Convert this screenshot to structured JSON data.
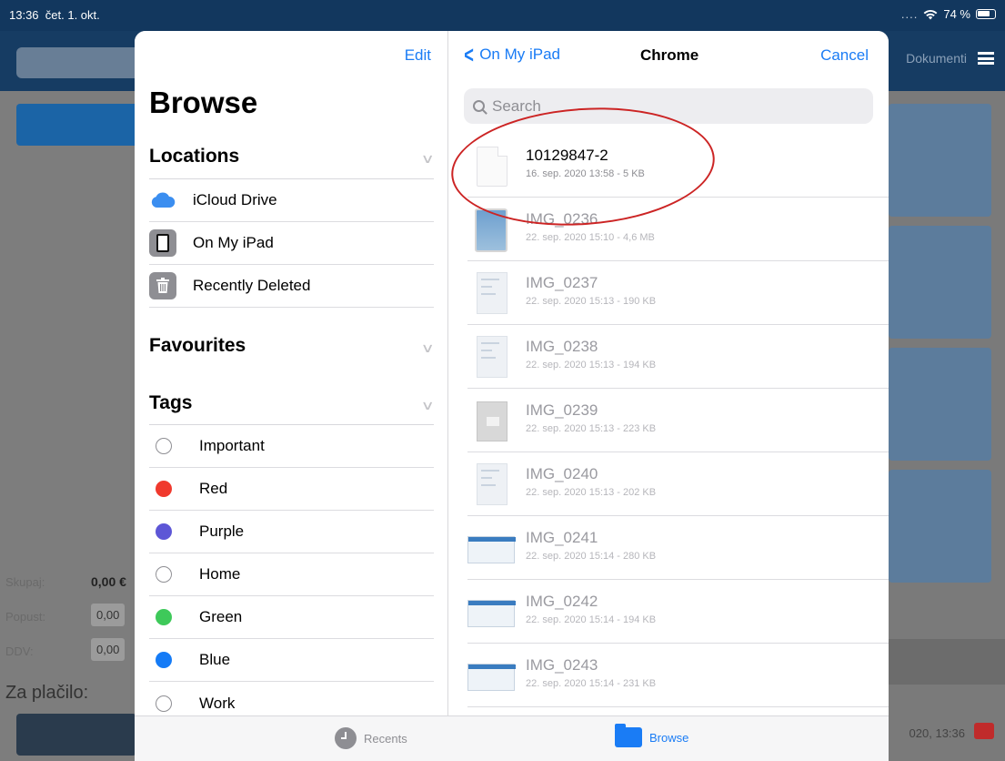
{
  "status": {
    "time": "13:36",
    "date": "čet. 1. okt.",
    "signal": "....",
    "wifi": "wifi-icon",
    "battery": "74 %"
  },
  "background": {
    "dokumenti_label": "Dokumenti",
    "skupaj_label": "Skupaj:",
    "skupaj_value": "0,00 €",
    "popust_label": "Popust:",
    "popust_value": "0,00",
    "ddv_label": "DDV:",
    "ddv_value": "0,00",
    "za_placilo_label": "Za plačilo:",
    "datetime": "020, 13:36"
  },
  "sidebar": {
    "edit_label": "Edit",
    "title": "Browse",
    "locations_label": "Locations",
    "locations": [
      {
        "label": "iCloud Drive",
        "icon": "cloud-icon"
      },
      {
        "label": "On My iPad",
        "icon": "ipad-icon"
      },
      {
        "label": "Recently Deleted",
        "icon": "trash-icon"
      }
    ],
    "favourites_label": "Favourites",
    "tags_label": "Tags",
    "tags": [
      {
        "label": "Important",
        "color": ""
      },
      {
        "label": "Red",
        "color": "#f0392d"
      },
      {
        "label": "Purple",
        "color": "#5d56d6"
      },
      {
        "label": "Home",
        "color": ""
      },
      {
        "label": "Green",
        "color": "#3ec95a"
      },
      {
        "label": "Blue",
        "color": "#157bf6"
      },
      {
        "label": "Work",
        "color": ""
      }
    ]
  },
  "content": {
    "back_label": "On My iPad",
    "title": "Chrome",
    "cancel_label": "Cancel",
    "search_placeholder": "Search",
    "files": [
      {
        "name": "10129847-2",
        "meta": "16. sep. 2020 13:58 - 5 KB",
        "thumb": "doc",
        "dim": false
      },
      {
        "name": "IMG_0236",
        "meta": "22. sep. 2020 15:10 - 4,6 MB",
        "thumb": "ipad",
        "dim": true
      },
      {
        "name": "IMG_0237",
        "meta": "22. sep. 2020 15:13 - 190 KB",
        "thumb": "shot",
        "dim": true
      },
      {
        "name": "IMG_0238",
        "meta": "22. sep. 2020 15:13 - 194 KB",
        "thumb": "shot",
        "dim": true
      },
      {
        "name": "IMG_0239",
        "meta": "22. sep. 2020 15:13 - 223 KB",
        "thumb": "gray",
        "dim": true
      },
      {
        "name": "IMG_0240",
        "meta": "22. sep. 2020 15:13 - 202 KB",
        "thumb": "shot",
        "dim": true
      },
      {
        "name": "IMG_0241",
        "meta": "22. sep. 2020 15:14 - 280 KB",
        "thumb": "wide",
        "dim": true
      },
      {
        "name": "IMG_0242",
        "meta": "22. sep. 2020 15:14 - 194 KB",
        "thumb": "wide",
        "dim": true
      },
      {
        "name": "IMG_0243",
        "meta": "22. sep. 2020 15:14 - 231 KB",
        "thumb": "wide",
        "dim": true
      }
    ]
  },
  "tabbar": {
    "recents_label": "Recents",
    "browse_label": "Browse"
  },
  "colors": {
    "accent": "#1a7cf5",
    "highlight_ring": "#cc2424"
  }
}
